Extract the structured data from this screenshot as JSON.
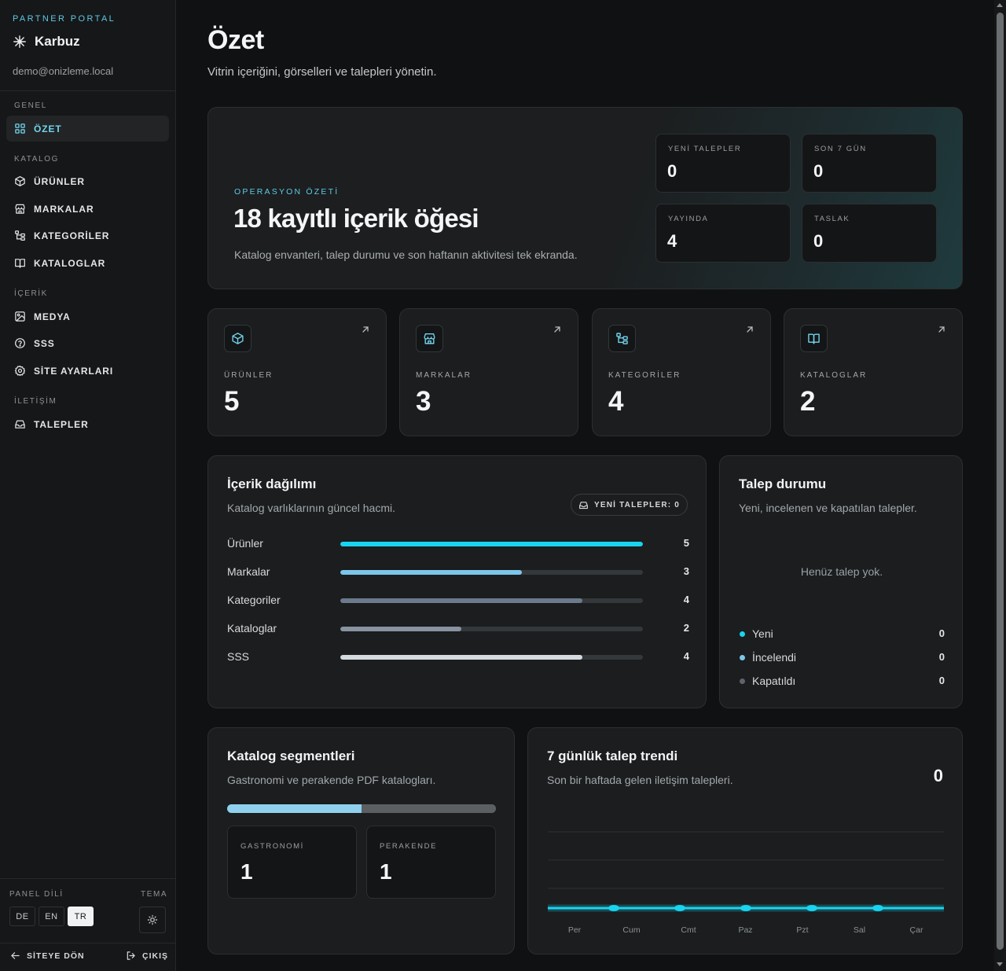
{
  "sidebar": {
    "portal_label": "PARTNER PORTAL",
    "brand": "Karbuz",
    "email": "demo@onizleme.local",
    "sections": {
      "general": "GENEL",
      "catalog": "KATALOG",
      "content": "İÇERİK",
      "contact": "İLETİŞİM"
    },
    "items": {
      "overview": "ÖZET",
      "products": "ÜRÜNLER",
      "brands": "MARKALAR",
      "categories": "KATEGORİLER",
      "catalogs": "KATALOGLAR",
      "media": "MEDYA",
      "faq": "SSS",
      "site_settings": "SİTE AYARLARI",
      "requests": "TALEPLER"
    },
    "panel_lang_label": "PANEL DİLİ",
    "theme_label": "TEMA",
    "langs": [
      "DE",
      "EN",
      "TR"
    ],
    "active_lang": "TR",
    "back_to_site": "SİTEYE DÖN",
    "logout": "ÇIKIŞ"
  },
  "header": {
    "title": "Özet",
    "subtitle": "Vitrin içeriğini, görselleri ve talepleri yönetin."
  },
  "hero": {
    "kicker": "OPERASYON ÖZETİ",
    "title": "18 kayıtlı içerik öğesi",
    "description": "Katalog envanteri, talep durumu ve son haftanın aktivitesi tek ekranda.",
    "stats": [
      {
        "label": "YENİ TALEPLER",
        "value": "0"
      },
      {
        "label": "SON 7 GÜN",
        "value": "0"
      },
      {
        "label": "YAYINDA",
        "value": "4"
      },
      {
        "label": "TASLAK",
        "value": "0"
      }
    ]
  },
  "stat_cards": [
    {
      "label": "ÜRÜNLER",
      "value": "5",
      "icon": "box-icon"
    },
    {
      "label": "MARKALAR",
      "value": "3",
      "icon": "store-icon"
    },
    {
      "label": "KATEGORİLER",
      "value": "4",
      "icon": "tree-icon"
    },
    {
      "label": "KATALOGLAR",
      "value": "2",
      "icon": "book-icon"
    }
  ],
  "distribution": {
    "title": "İçerik dağılımı",
    "subtitle": "Katalog varlıklarının güncel hacmi.",
    "badge": "YENİ TALEPLER: 0",
    "max": 5,
    "rows": [
      {
        "label": "Ürünler",
        "value": 5,
        "display": "5",
        "color": "#19d4f0"
      },
      {
        "label": "Markalar",
        "value": 3,
        "display": "3",
        "color": "#7cc6ec"
      },
      {
        "label": "Kategoriler",
        "value": 4,
        "display": "4",
        "color": "#6b7a8c"
      },
      {
        "label": "Kataloglar",
        "value": 2,
        "display": "2",
        "color": "#8892a0"
      },
      {
        "label": "SSS",
        "value": 4,
        "display": "4",
        "color": "#d4dae0"
      }
    ]
  },
  "request_status": {
    "title": "Talep durumu",
    "subtitle": "Yeni, incelenen ve kapatılan talepler.",
    "empty": "Henüz talep yok.",
    "legend": [
      {
        "label": "Yeni",
        "value": "0",
        "color": "#19d4f0"
      },
      {
        "label": "İncelendi",
        "value": "0",
        "color": "#7cc6ec"
      },
      {
        "label": "Kapatıldı",
        "value": "0",
        "color": "#5d646c"
      }
    ]
  },
  "segments": {
    "title": "Katalog segmentleri",
    "subtitle": "Gastronomi ve perakende PDF katalogları.",
    "items": [
      {
        "label": "GASTRONOMİ",
        "value": "1",
        "share": 0.5,
        "color": "#8fd0ee"
      },
      {
        "label": "PERAKENDE",
        "value": "1",
        "share": 0.5,
        "color": "#5b5f62"
      }
    ]
  },
  "trend": {
    "title": "7 günlük talep trendi",
    "subtitle": "Son bir haftada gelen iletişim talepleri.",
    "total": "0",
    "chart_data": {
      "type": "line",
      "categories": [
        "Per",
        "Cum",
        "Cmt",
        "Paz",
        "Pzt",
        "Sal",
        "Çar"
      ],
      "values": [
        0,
        0,
        0,
        0,
        0,
        0,
        0
      ],
      "ylim": [
        0,
        3
      ],
      "grid": true
    },
    "line_color": "#19d4f0"
  }
}
